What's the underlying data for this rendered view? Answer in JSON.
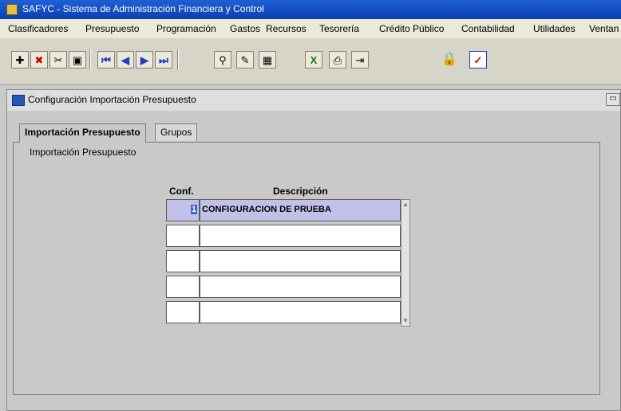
{
  "titlebar": {
    "title": "SAFYC - Sistema de Administración Financiera y Control"
  },
  "menu": [
    "Clasificadores",
    "Presupuesto",
    "Programación",
    "Gastos",
    "Recursos",
    "Tesorería",
    "Crédito Público",
    "Contabilidad",
    "Utilidades",
    "Ventan"
  ],
  "toolbar": {
    "icons": [
      "insert-record-icon",
      "delete-record-icon",
      "cut-icon",
      "save-icon",
      "first-record-icon",
      "previous-record-icon",
      "next-record-icon",
      "last-record-icon",
      "filter-icon",
      "query-icon",
      "calculator-icon",
      "excel-icon",
      "print-icon",
      "exit-icon",
      "lock-icon",
      "checkbox-icon"
    ]
  },
  "window": {
    "title": "Configuración Importación Presupuesto",
    "tabs": [
      {
        "label": "Importación Presupuesto",
        "active": true
      },
      {
        "label": "Grupos",
        "active": false
      }
    ],
    "panel_label": "Importación Presupuesto",
    "table": {
      "headers": {
        "conf": "Conf.",
        "descripcion": "Descripción"
      },
      "rows": [
        {
          "conf": "1",
          "descripcion": "CONFIGURACION DE PRUEBA",
          "selected": true
        },
        {
          "conf": "",
          "descripcion": "",
          "selected": false
        },
        {
          "conf": "",
          "descripcion": "",
          "selected": false
        },
        {
          "conf": "",
          "descripcion": "",
          "selected": false
        },
        {
          "conf": "",
          "descripcion": "",
          "selected": false
        }
      ]
    }
  }
}
